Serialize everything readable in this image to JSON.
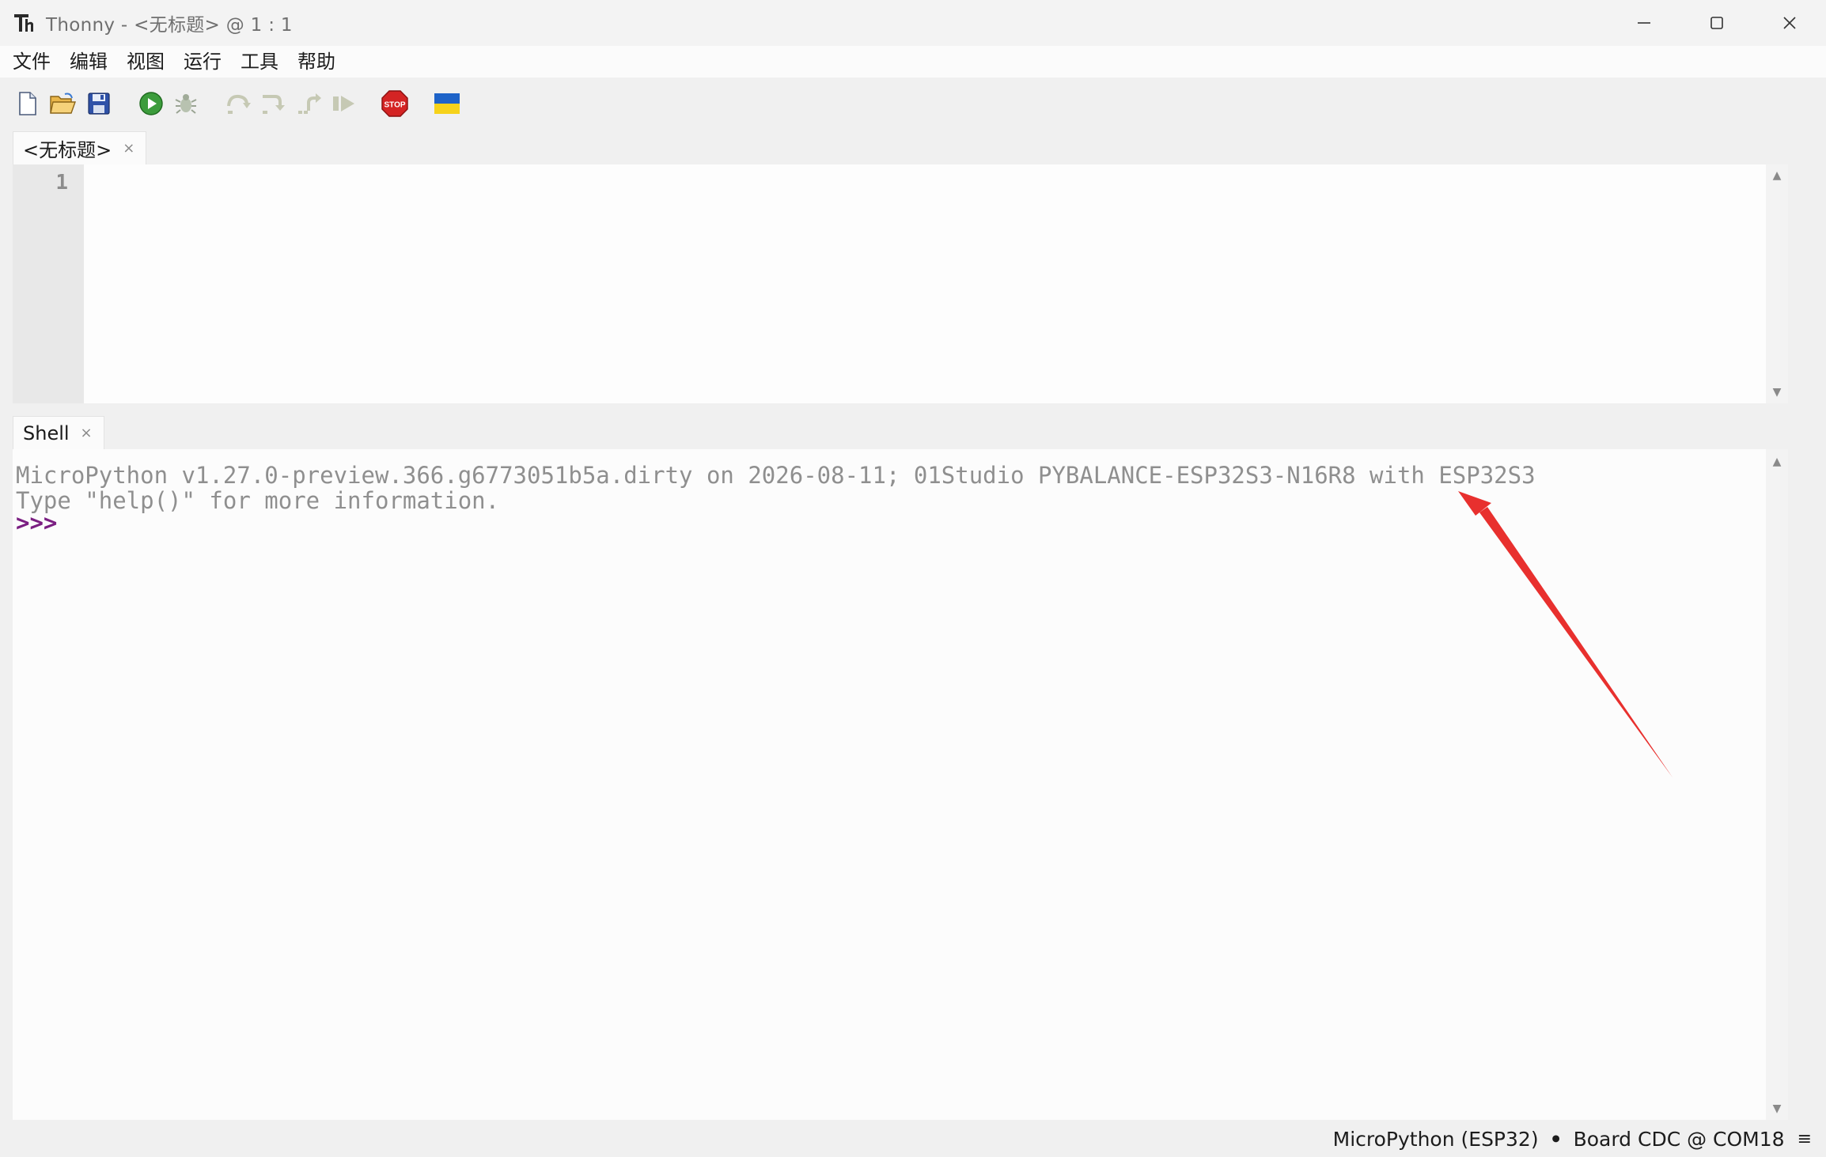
{
  "window": {
    "title": "Thonny  -  <无标题>  @  1 : 1",
    "controls": [
      "minimize-icon",
      "maximize-icon",
      "close-icon"
    ]
  },
  "menu": {
    "items": [
      "文件",
      "编辑",
      "视图",
      "运行",
      "工具",
      "帮助"
    ]
  },
  "toolbar": {
    "tools": [
      "new-file-icon",
      "open-file-icon",
      "save-icon",
      "run-icon",
      "debug-icon",
      "step-over-icon",
      "step-into-icon",
      "step-out-icon",
      "resume-icon",
      "stop-icon",
      "ukraine-flag-icon"
    ],
    "colors": {
      "run": "#3c9c3c",
      "stop": "#d42424",
      "flag_blue": "#1e63c8",
      "flag_yellow": "#f6d21a"
    }
  },
  "editor": {
    "tab_label": "<无标题>",
    "tab_close": "×",
    "line_numbers": [
      "1"
    ]
  },
  "shell": {
    "tab_label": "Shell",
    "tab_close": "×",
    "lines": [
      "MicroPython v1.27.0-preview.366.g6773051b5a.dirty on 2026-08-11; 01Studio PYBALANCE-ESP32S3-N16R8 with ESP32S3",
      "Type \"help()\" for more information."
    ],
    "prompt": ">>>"
  },
  "statusbar": {
    "interpreter": "MicroPython (ESP32)",
    "separator": "•",
    "port": "Board CDC @ COM18",
    "menu": "≡"
  },
  "annotation": {
    "arrow_color": "#e8302e"
  }
}
